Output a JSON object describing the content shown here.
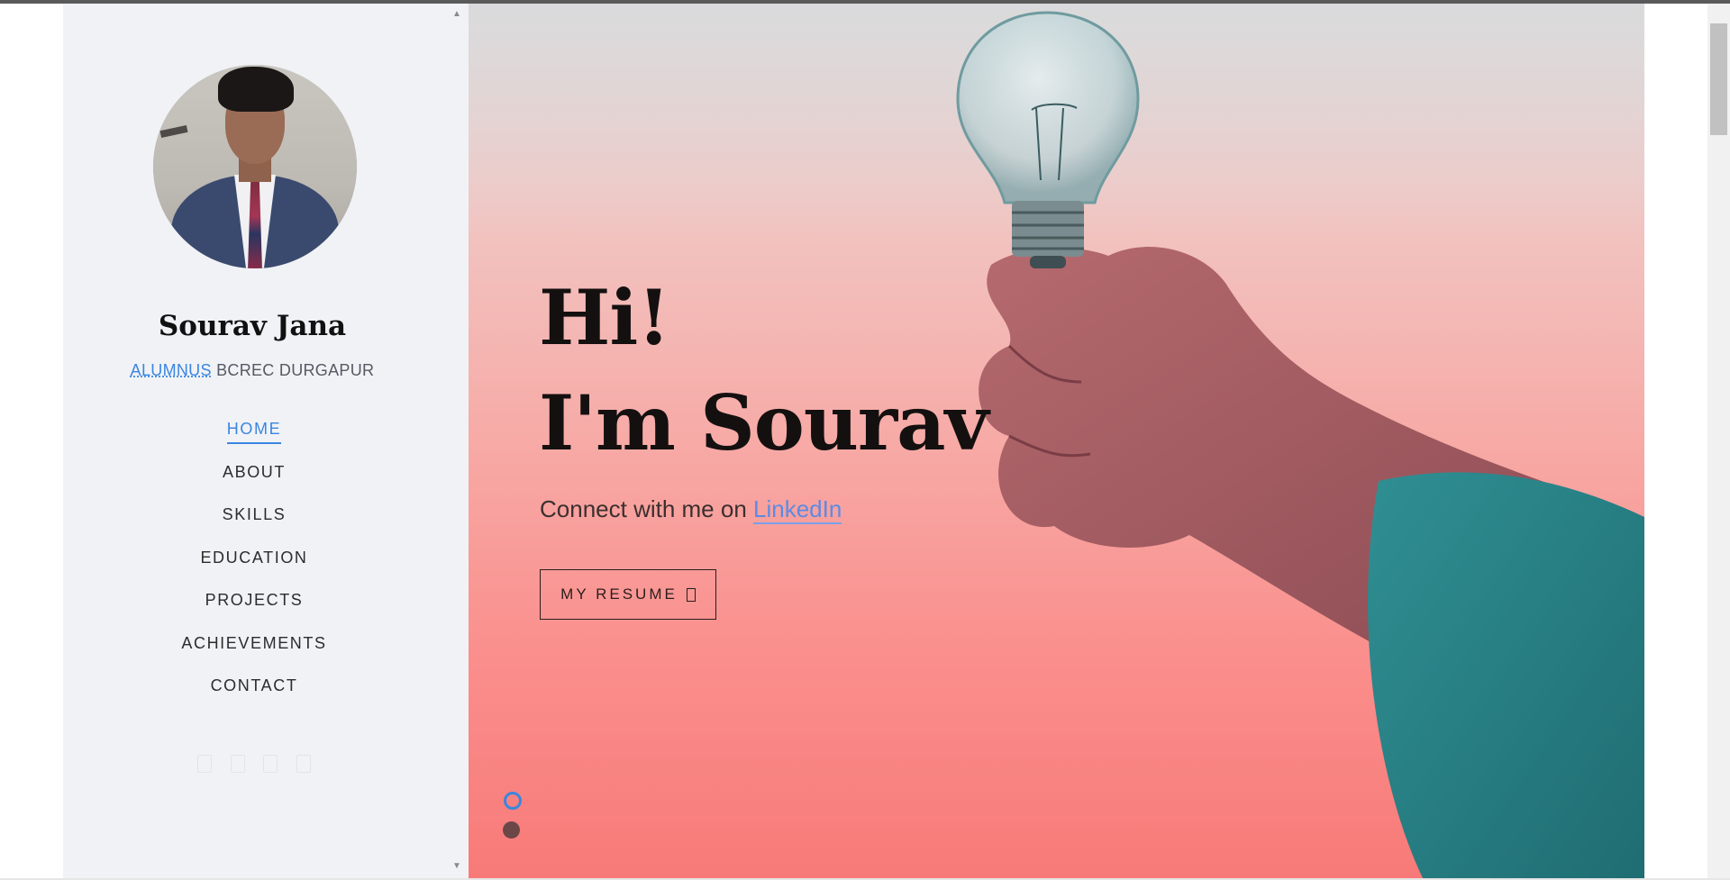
{
  "sidebar": {
    "name": "Sourav Jana",
    "subtitle_abbr": "ALUMNUS",
    "subtitle_rest": " BCREC DURGAPUR",
    "nav": [
      {
        "label": "HOME",
        "active": true
      },
      {
        "label": "ABOUT",
        "active": false
      },
      {
        "label": "SKILLS",
        "active": false
      },
      {
        "label": "EDUCATION",
        "active": false
      },
      {
        "label": "PROJECTS",
        "active": false
      },
      {
        "label": "ACHIEVEMENTS",
        "active": false
      },
      {
        "label": "CONTACT",
        "active": false
      }
    ],
    "social_icons": [
      "facebook-icon",
      "twitter-icon",
      "linkedin-icon",
      "github-icon"
    ]
  },
  "hero": {
    "line1": "Hi!",
    "line2": "I'm Sourav",
    "connect_prefix": "Connect with me on ",
    "connect_link": "LinkedIn",
    "resume_label": "MY RESUME",
    "resume_icon": "download-icon",
    "slides": [
      {
        "active": true
      },
      {
        "active": false
      }
    ]
  },
  "colors": {
    "accent": "#3a86e0",
    "sidebar_bg": "#f1f2f6",
    "hero_bg": "#f7aaa6"
  }
}
